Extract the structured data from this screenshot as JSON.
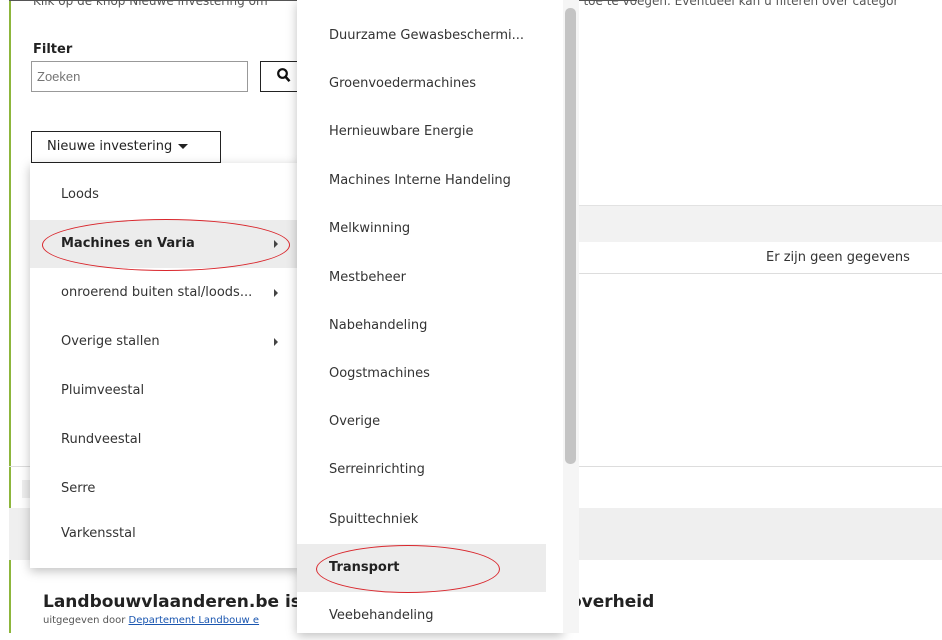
{
  "page": {
    "intro_left": "Klik op de knop Nieuwe investering om",
    "intro_right": "n/ toe te voegen. Eventueel kan u filteren over categor",
    "filter_label": "Filter",
    "search_placeholder": "Zoeken",
    "new_investment_label": "Nieuwe investering",
    "no_data": "Er zijn geen gegevens"
  },
  "menu": {
    "items": [
      {
        "label": "Loods",
        "has_submenu": false
      },
      {
        "label": "Machines en Varia",
        "has_submenu": true,
        "active": true
      },
      {
        "label": "onroerend buiten stal/loods...",
        "has_submenu": true
      },
      {
        "label": "Overige stallen",
        "has_submenu": true
      },
      {
        "label": "Pluimveestal",
        "has_submenu": false
      },
      {
        "label": "Rundveestal",
        "has_submenu": false
      },
      {
        "label": "Serre",
        "has_submenu": false
      },
      {
        "label": "Varkensstal",
        "has_submenu": false
      }
    ]
  },
  "submenu": {
    "items": [
      {
        "label": "Duurzame Gewasbeschermi..."
      },
      {
        "label": "Groenvoedermachines"
      },
      {
        "label": "Hernieuwbare Energie"
      },
      {
        "label": "Machines Interne Handeling"
      },
      {
        "label": "Melkwinning"
      },
      {
        "label": "Mestbeheer"
      },
      {
        "label": "Nabehandeling"
      },
      {
        "label": "Oogstmachines"
      },
      {
        "label": "Overige"
      },
      {
        "label": "Serreinrichting"
      },
      {
        "label": "Spuittechniek"
      },
      {
        "label": "Transport",
        "active": true
      },
      {
        "label": "Veebehandeling"
      }
    ]
  },
  "footer": {
    "title_left": "Landbouwvlaanderen.be is eer",
    "title_right": "overheid",
    "sub_prefix": "uitgegeven door",
    "sub_link": "Departement Landbouw e"
  },
  "colors": {
    "accent_border": "#8db63c",
    "highlight_ellipse": "#d9262c",
    "link": "#1a56b0"
  }
}
